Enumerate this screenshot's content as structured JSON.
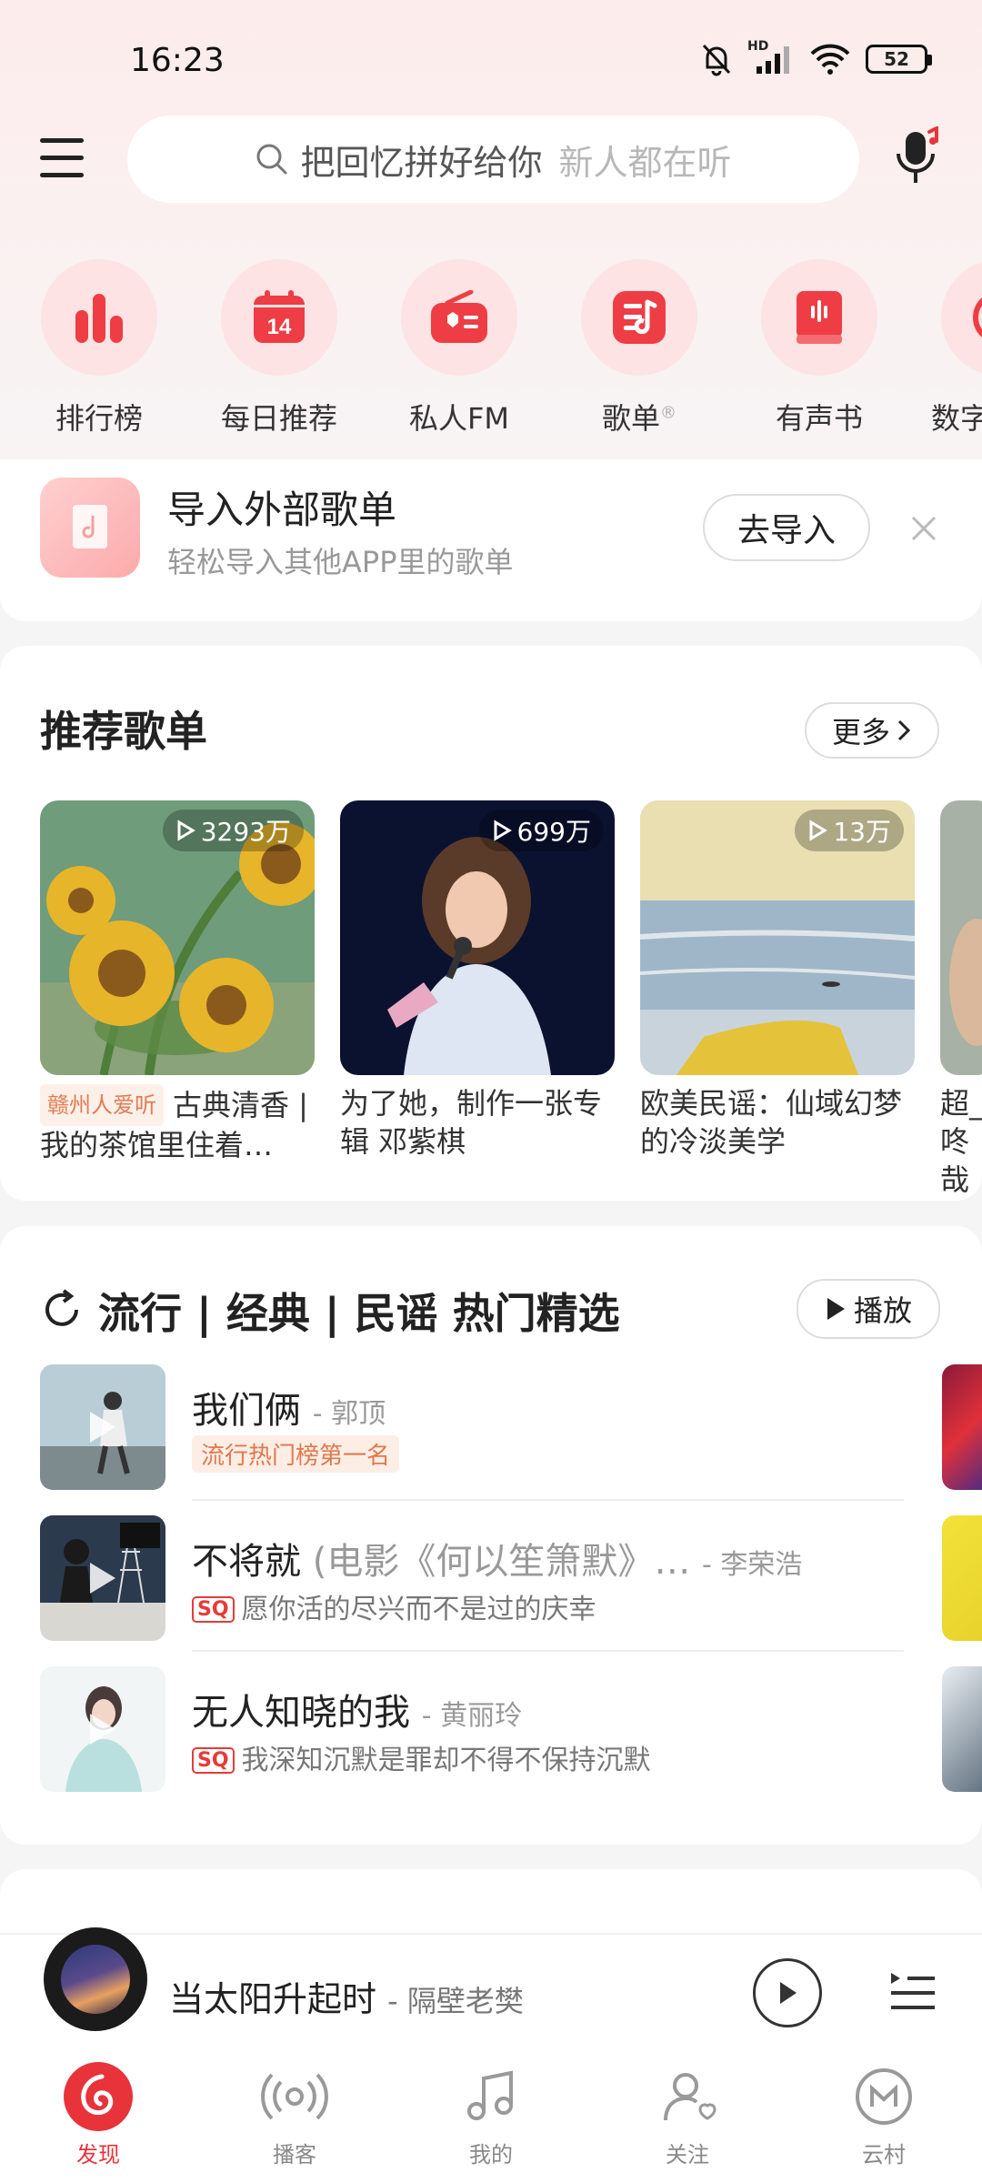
{
  "status_bar": {
    "time": "16:23",
    "battery": "52",
    "network": "HD"
  },
  "search": {
    "keyword": "把回忆拼好给你",
    "hint": "新人都在听"
  },
  "quick_nav": [
    {
      "label": "排行榜",
      "icon": "chart-bars-icon"
    },
    {
      "label": "每日推荐",
      "icon": "calendar-icon",
      "badge": "14"
    },
    {
      "label": "私人FM",
      "icon": "radio-icon"
    },
    {
      "label": "歌单",
      "icon": "playlist-icon",
      "mark": "®"
    },
    {
      "label": "有声书",
      "icon": "audiobook-icon"
    },
    {
      "label": "数字",
      "icon": "partial-icon"
    }
  ],
  "import_card": {
    "title": "导入外部歌单",
    "subtitle": "轻松导入其他APP里的歌单",
    "button": "去导入"
  },
  "recommend": {
    "title": "推荐歌单",
    "more": "更多",
    "playlists": [
      {
        "count": "3293万",
        "tag": "赣州人爱听",
        "name": "古典清香 | 我的茶馆里住着…"
      },
      {
        "count": "699万",
        "name": "为了她，制作一张专辑 邓紫棋"
      },
      {
        "count": "13万",
        "name": "欧美民谣：仙域幻梦的冷淡美学"
      },
      {
        "name": "超_ 咚哉"
      }
    ]
  },
  "hot_section": {
    "title": "流行 | 经典 | 民谣 热门精选",
    "play_button": "播放",
    "songs": [
      {
        "title": "我们俩",
        "artist": "郭顶",
        "tag": "流行热门榜第一名"
      },
      {
        "title": "不将就",
        "extra": "(电影《何以笙箫默》…",
        "artist": "李荣浩",
        "quality": "SQ",
        "desc": "愿你活的尽兴而不是过的庆幸"
      },
      {
        "title": "无人知晓的我",
        "artist": "黄丽玲",
        "quality": "SQ",
        "desc": "我深知沉默是罪却不得不保持沉默"
      }
    ]
  },
  "player": {
    "title": "当太阳升起时",
    "artist": "隔壁老樊"
  },
  "bottom_nav": [
    {
      "label": "发现",
      "active": true
    },
    {
      "label": "播客"
    },
    {
      "label": "我的"
    },
    {
      "label": "关注"
    },
    {
      "label": "云村"
    }
  ],
  "colors": {
    "accent": "#e8333a",
    "quick_circle": "#fde3e3",
    "tag": "#e0794e"
  }
}
